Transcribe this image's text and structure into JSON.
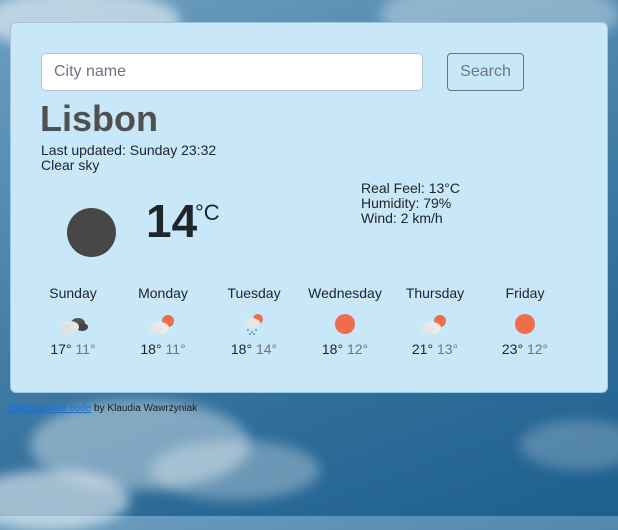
{
  "search": {
    "placeholder": "City name",
    "button_label": "Search"
  },
  "current": {
    "city": "Lisbon",
    "last_updated": "Last updated: Sunday 23:32",
    "description": "Clear sky",
    "temperature": "14",
    "unit": "°C",
    "icon": "moon-icon",
    "real_feel": "Real Feel: 13°C",
    "humidity": "Humidity: 79%",
    "wind": "Wind: 2 km/h"
  },
  "forecast": [
    {
      "day": "Sunday",
      "max": "17°",
      "min": "11°",
      "icon": "night-broken-clouds-icon"
    },
    {
      "day": "Monday",
      "max": "18°",
      "min": "11°",
      "icon": "few-clouds-icon"
    },
    {
      "day": "Tuesday",
      "max": "18°",
      "min": "14°",
      "icon": "rain-icon"
    },
    {
      "day": "Wednesday",
      "max": "18°",
      "min": "12°",
      "icon": "sun-icon"
    },
    {
      "day": "Thursday",
      "max": "21°",
      "min": "13°",
      "icon": "few-clouds-icon"
    },
    {
      "day": "Friday",
      "max": "23°",
      "min": "12°",
      "icon": "sun-icon"
    }
  ],
  "footer": {
    "link_text": "Open-source code",
    "author_text": " by Klaudia Wawrzyniak"
  },
  "colors": {
    "card_bg": "#c8e8f9",
    "sun": "#ef6c4c",
    "moon": "#474747"
  }
}
